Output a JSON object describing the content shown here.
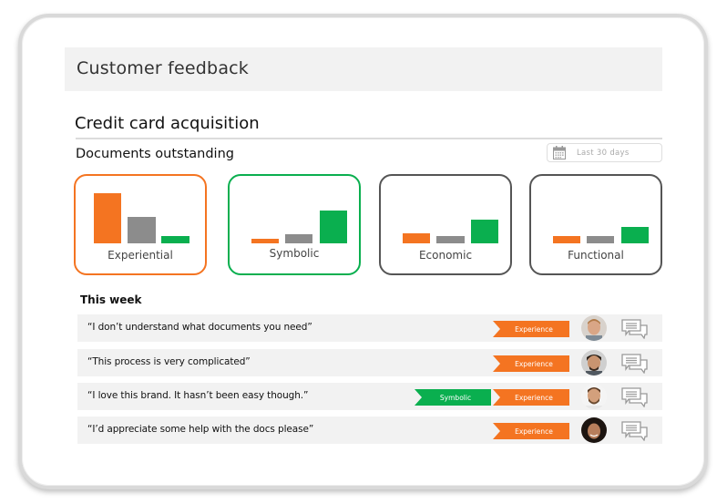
{
  "header": {
    "title": "Customer feedback"
  },
  "section": {
    "title": "Credit card acquisition",
    "subtitle": "Documents outstanding",
    "date_filter": {
      "icon": "calendar-icon",
      "label": "Last  30 days"
    }
  },
  "colors": {
    "orange": "#f47421",
    "grey": "#8c8c8c",
    "green": "#0aaf4f",
    "neutral_border": "#555555"
  },
  "chart_data": {
    "type": "bar",
    "title": "Documents outstanding",
    "legend_series": [
      "orange",
      "grey",
      "green"
    ],
    "charts": [
      {
        "label": "Experiential",
        "highlight": "orange",
        "values": [
          55,
          29,
          8
        ]
      },
      {
        "label": "Symbolic",
        "highlight": "green",
        "values": [
          5,
          10,
          36
        ]
      },
      {
        "label": "Economic",
        "highlight": "none",
        "values": [
          11,
          8,
          26
        ]
      },
      {
        "label": "Functional",
        "highlight": "none",
        "values": [
          8,
          8,
          18
        ]
      }
    ],
    "ylim": [
      0,
      60
    ]
  },
  "feed": {
    "title": "This week",
    "rows": [
      {
        "quote": "“I don’t understand what documents you need”",
        "tags": [
          {
            "label": "Experience",
            "color": "orange"
          }
        ],
        "avatar": "avatar-man-blond",
        "action_icon": "chat-icon"
      },
      {
        "quote": "“This process is very complicated”",
        "tags": [
          {
            "label": "Experience",
            "color": "orange"
          }
        ],
        "avatar": "avatar-man-dark-hair",
        "action_icon": "chat-icon"
      },
      {
        "quote": "“I love this brand. It hasn’t been easy though.”",
        "tags": [
          {
            "label": "Symbolic",
            "color": "green"
          },
          {
            "label": "Experience",
            "color": "orange"
          }
        ],
        "avatar": "avatar-man-beard",
        "action_icon": "chat-icon"
      },
      {
        "quote": "“I’d appreciate some help with the docs please”",
        "tags": [
          {
            "label": "Experience",
            "color": "orange"
          }
        ],
        "avatar": "avatar-woman-curly",
        "action_icon": "chat-icon"
      }
    ]
  }
}
